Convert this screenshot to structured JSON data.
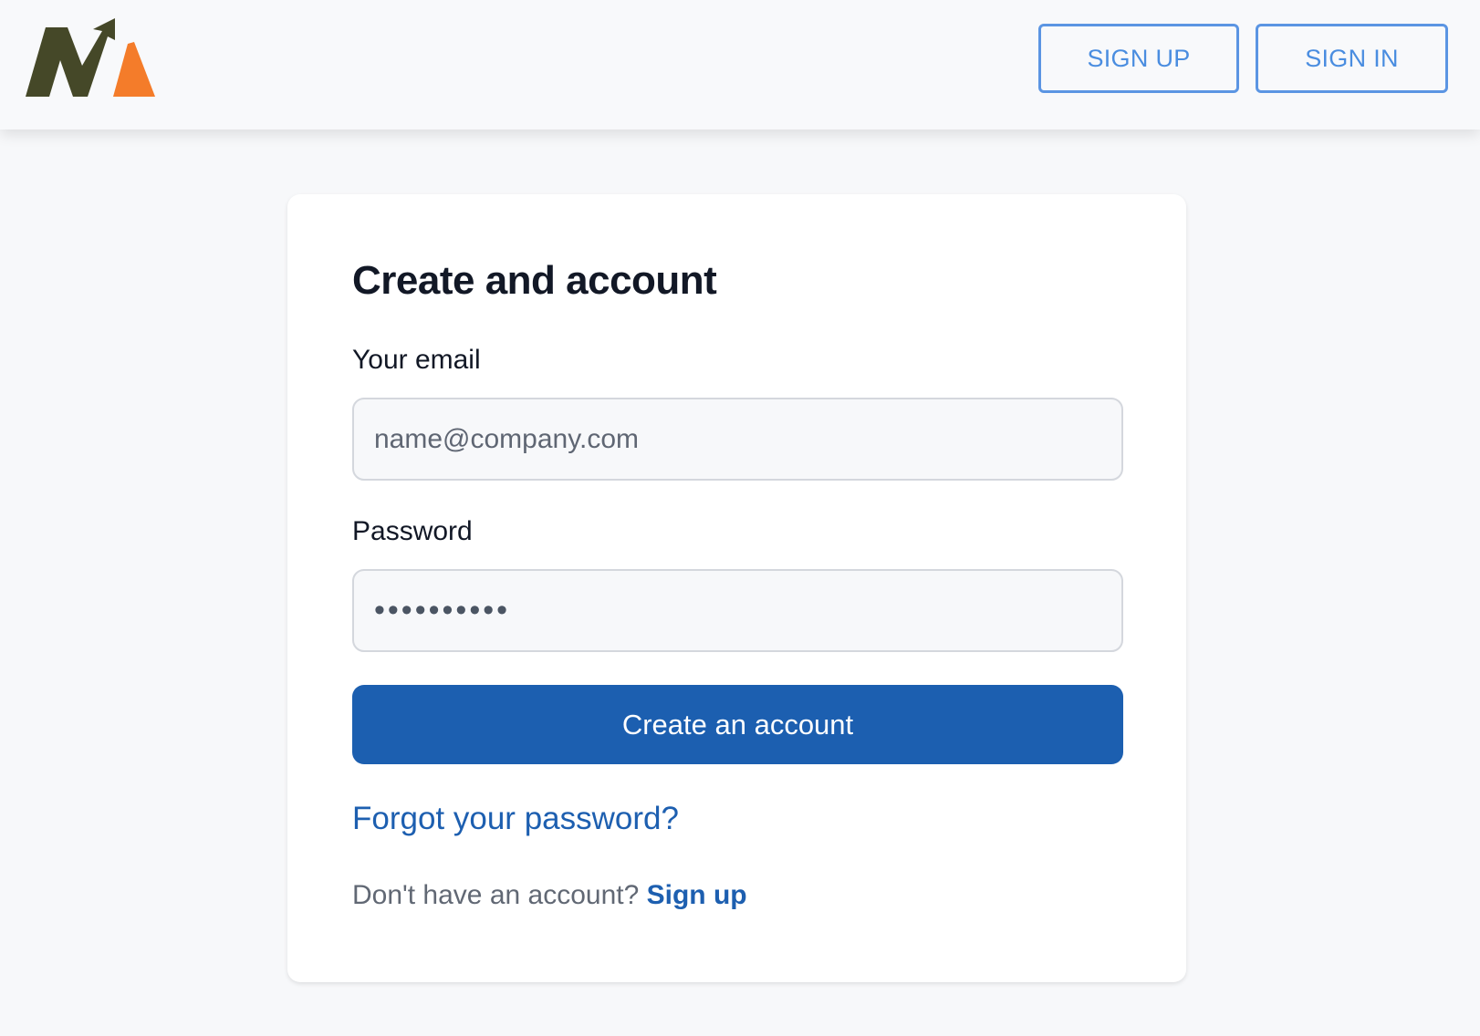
{
  "colors": {
    "page_background": "#f7f8fa",
    "header_background": "#f8f9fb",
    "header_button": "#4a8de0",
    "primary_button": "#1c5fb0",
    "link": "#1d5fb0",
    "logo_dark": "#454828",
    "logo_accent": "#f47c2a"
  },
  "header": {
    "logo_icon": "brand-logo-icon",
    "signup_label": "SIGN UP",
    "signin_label": "SIGN IN"
  },
  "form": {
    "title": "Create and account",
    "email_label": "Your email",
    "email_placeholder": "name@company.com",
    "password_label": "Password",
    "password_value": "••••••••••",
    "submit_label": "Create an account",
    "forgot_label": "Forgot your password?",
    "no_account_text": "Don't have an account?",
    "signup_link_label": "Sign up"
  }
}
